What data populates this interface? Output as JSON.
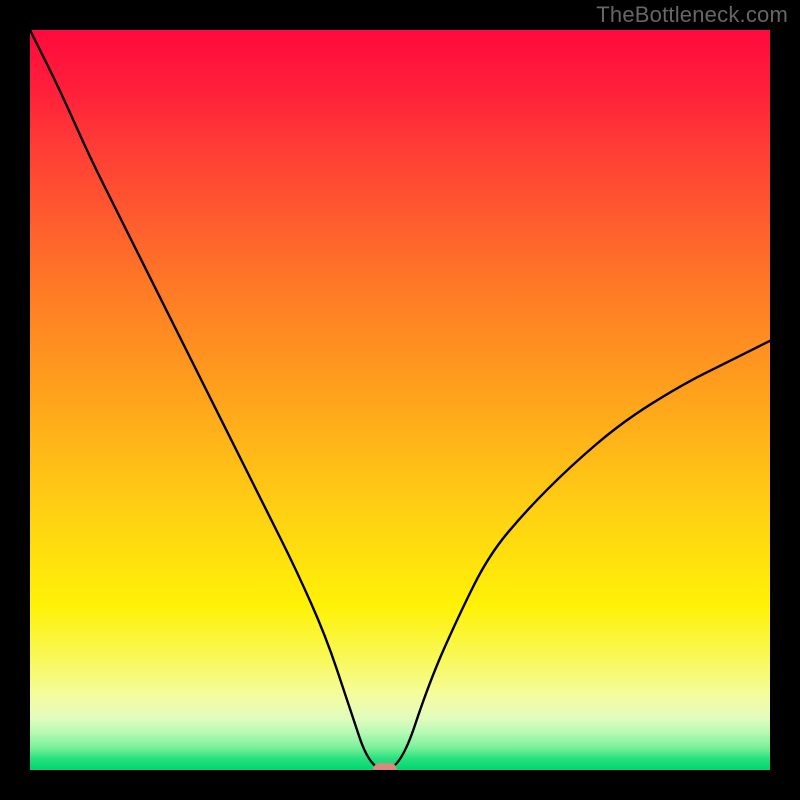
{
  "attribution": "TheBottleneck.com",
  "chart_data": {
    "type": "line",
    "title": "",
    "xlabel": "",
    "ylabel": "",
    "xlim": [
      0,
      1
    ],
    "ylim": [
      0,
      100
    ],
    "grid": false,
    "legend": false,
    "background": {
      "kind": "vertical-gradient",
      "stops": [
        {
          "pos": 0.0,
          "color": "#ff0a3d"
        },
        {
          "pos": 0.08,
          "color": "#ff1f3b"
        },
        {
          "pos": 0.16,
          "color": "#ff3d36"
        },
        {
          "pos": 0.25,
          "color": "#ff5a2f"
        },
        {
          "pos": 0.35,
          "color": "#ff7a26"
        },
        {
          "pos": 0.5,
          "color": "#ffa41c"
        },
        {
          "pos": 0.65,
          "color": "#ffd013"
        },
        {
          "pos": 0.78,
          "color": "#fff207"
        },
        {
          "pos": 0.85,
          "color": "#f8f85a"
        },
        {
          "pos": 0.9,
          "color": "#f5fca0"
        },
        {
          "pos": 0.93,
          "color": "#e2fcbd"
        },
        {
          "pos": 0.95,
          "color": "#b5f9b5"
        },
        {
          "pos": 0.97,
          "color": "#78f198"
        },
        {
          "pos": 0.985,
          "color": "#25e07e"
        },
        {
          "pos": 1.0,
          "color": "#00d66f"
        }
      ]
    },
    "series": [
      {
        "name": "bottleneck-curve",
        "color": "#000000",
        "x": [
          0.0,
          0.04,
          0.08,
          0.12,
          0.16,
          0.2,
          0.24,
          0.28,
          0.32,
          0.36,
          0.4,
          0.43,
          0.46,
          0.5,
          0.54,
          0.58,
          0.62,
          0.67,
          0.73,
          0.8,
          0.88,
          0.94,
          1.0
        ],
        "y": [
          100,
          92,
          83,
          75,
          67,
          59,
          51,
          43,
          35,
          27,
          18,
          9,
          0.0,
          0.0,
          12,
          21,
          29,
          35,
          41,
          47,
          52,
          55,
          58
        ]
      }
    ],
    "marker": {
      "x": 0.48,
      "y": 0.0,
      "shape": "pill",
      "color": "#d88a7e"
    }
  }
}
